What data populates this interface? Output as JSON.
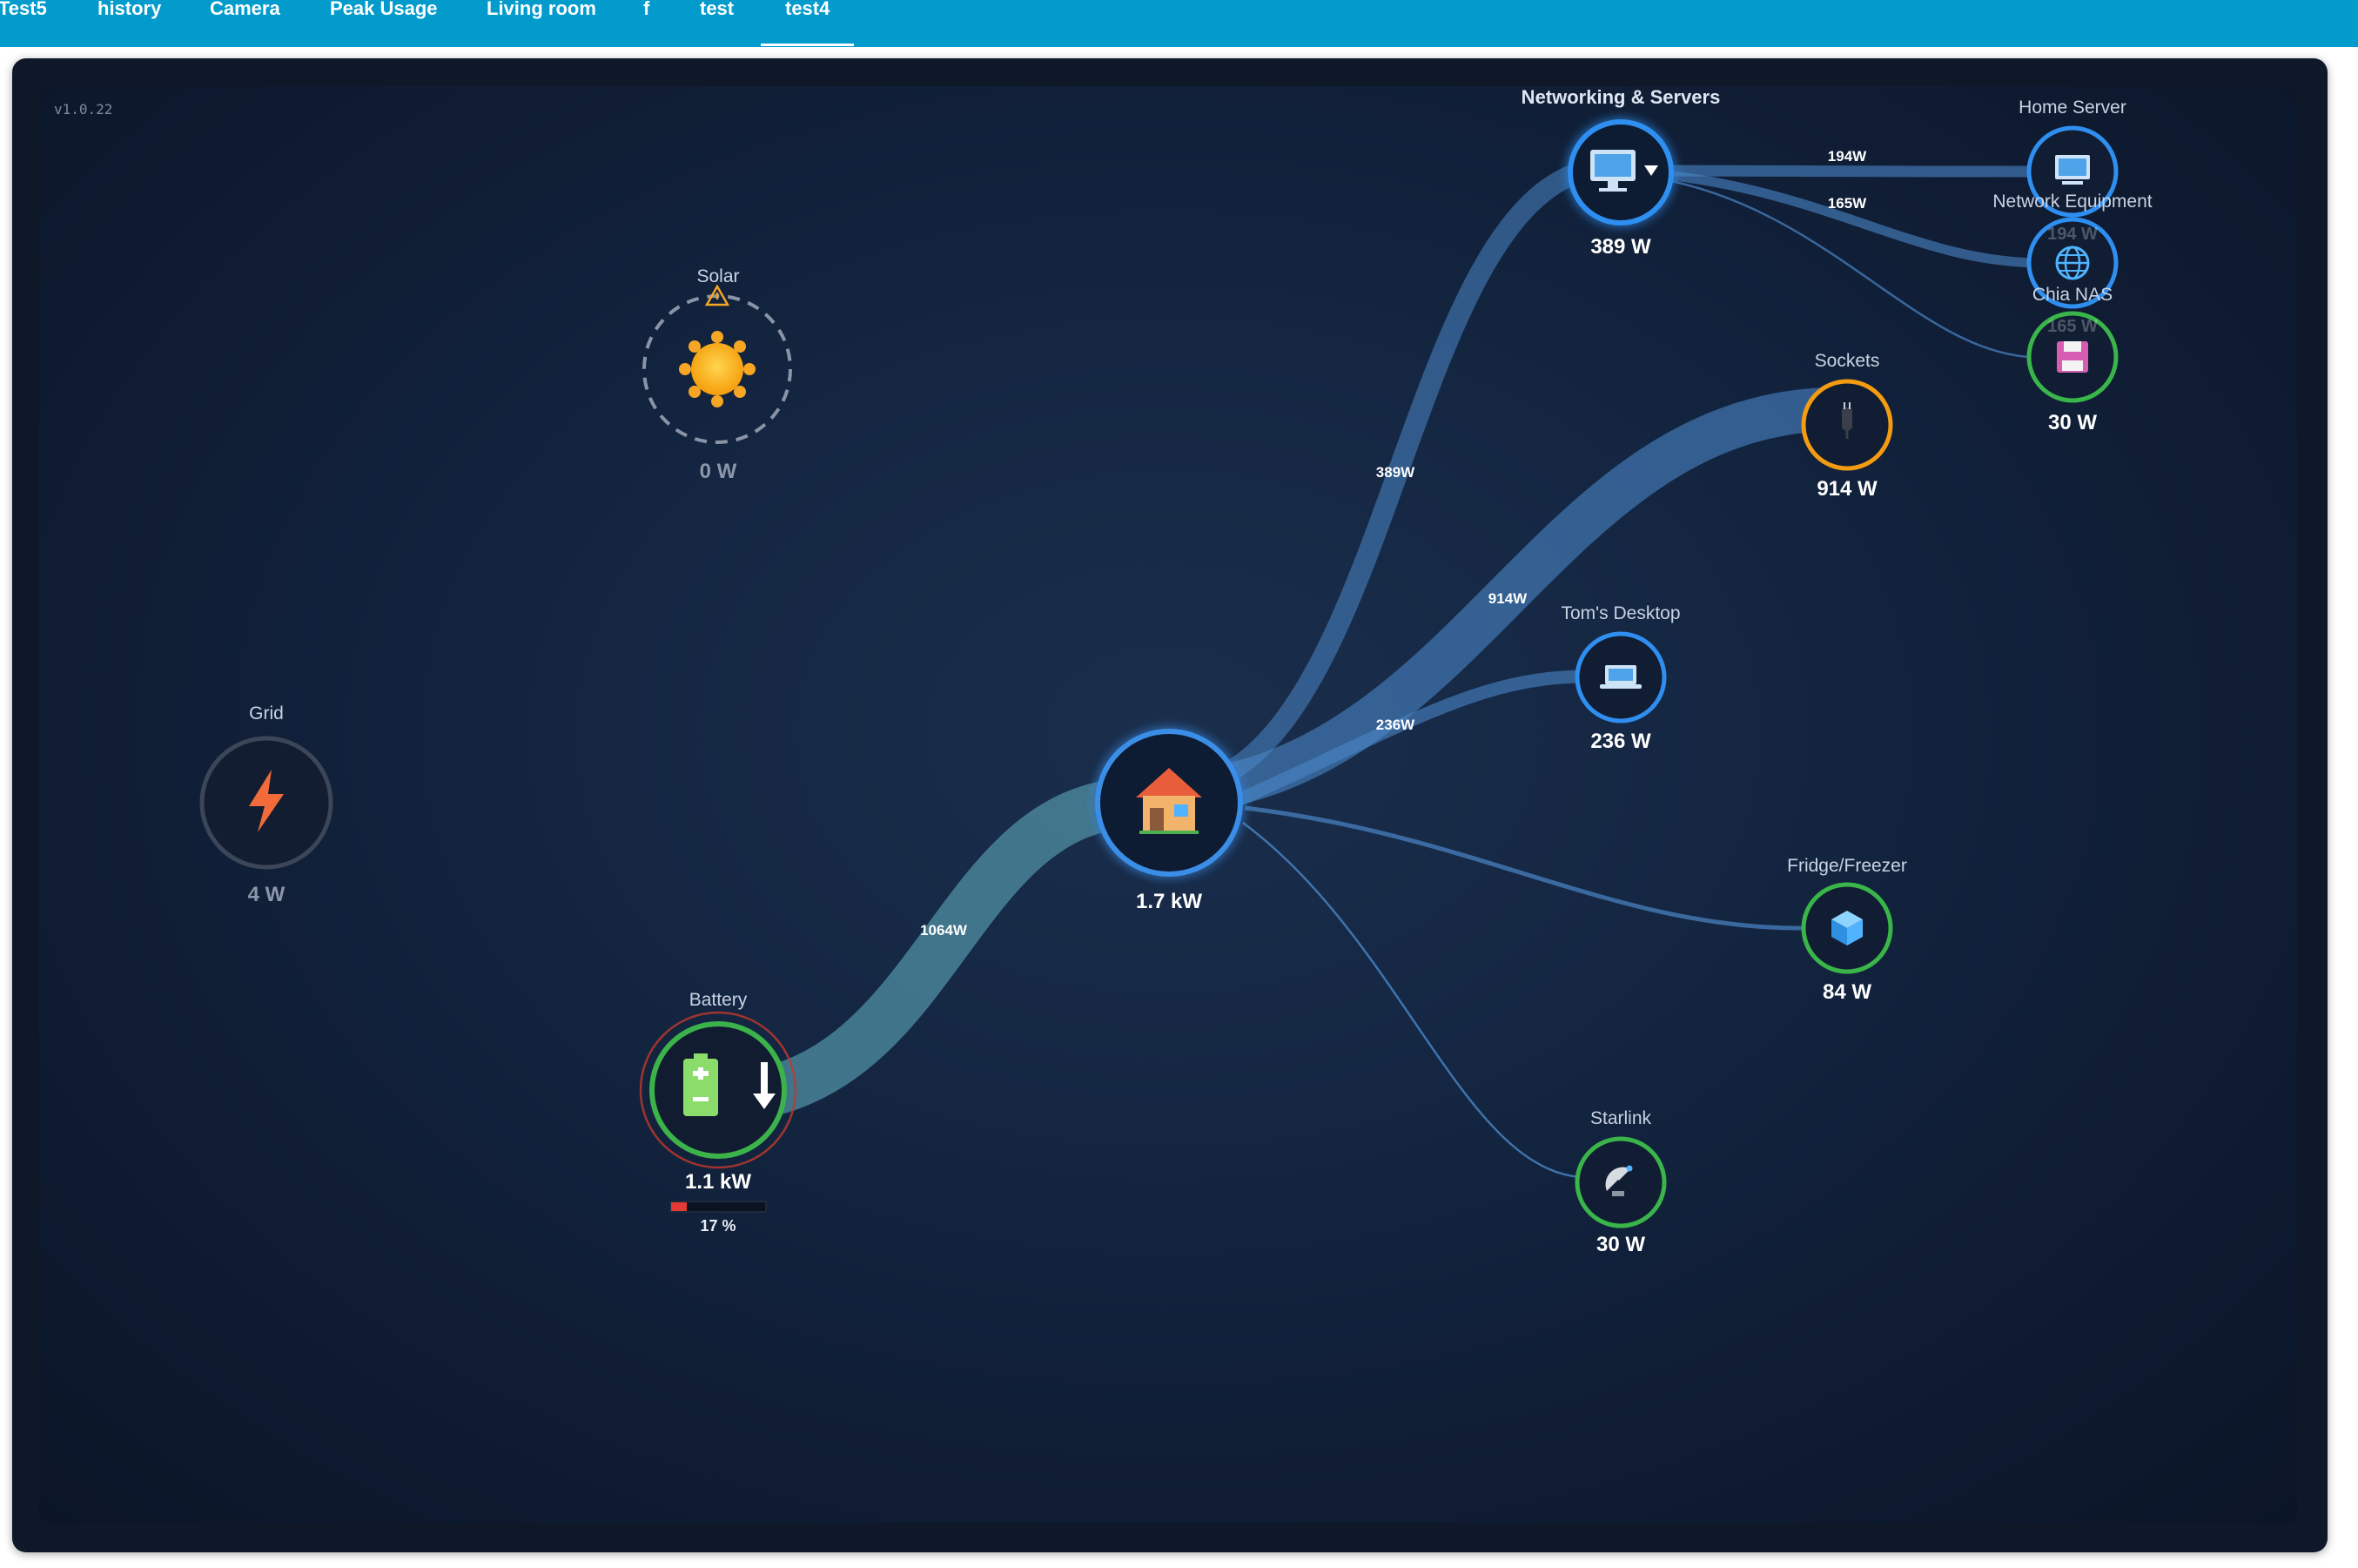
{
  "tabs": [
    {
      "label": "Test5"
    },
    {
      "label": "history"
    },
    {
      "label": "Camera"
    },
    {
      "label": "Peak Usage"
    },
    {
      "label": "Living room"
    },
    {
      "label": "f"
    },
    {
      "label": "test"
    },
    {
      "label": "test4",
      "active": true
    }
  ],
  "version": "v1.0.22",
  "colors": {
    "tabbar": "#039bcc",
    "flow": "#4b8ed0",
    "battery_flow": "#4f8fa3",
    "ring_blue": "#2f8ff0",
    "ring_green": "#39b54a",
    "ring_orange": "#f39c12",
    "ring_gray": "#3b4658",
    "battery_low": "#e53935"
  },
  "sources": {
    "solar": {
      "label": "Solar",
      "value": "0 W",
      "icon": "sun-icon",
      "warning": true
    },
    "grid": {
      "label": "Grid",
      "value": "4 W",
      "icon": "lightning-icon"
    },
    "battery": {
      "label": "Battery",
      "value": "1.1 kW",
      "icon": "battery-icon",
      "direction": "discharging",
      "percent_label": "17 %",
      "percent": 17
    }
  },
  "home": {
    "value": "1.7 kW",
    "icon": "house-icon"
  },
  "consumers": {
    "networking": {
      "label": "Networking & Servers",
      "value": "389 W",
      "icon": "computer-icon"
    },
    "home_server": {
      "label": "Home Server",
      "value": "194 W",
      "icon": "computer-icon"
    },
    "network_equipment": {
      "label": "Network Equipment",
      "value": "165 W",
      "icon": "globe-icon"
    },
    "chia_nas": {
      "label": "Chia NAS",
      "value": "30 W",
      "icon": "floppy-disk-icon"
    },
    "sockets": {
      "label": "Sockets",
      "value": "914 W",
      "icon": "plug-icon"
    },
    "toms_desktop": {
      "label": "Tom's Desktop",
      "value": "236 W",
      "icon": "laptop-icon"
    },
    "fridge": {
      "label": "Fridge/Freezer",
      "value": "84 W",
      "icon": "cube-icon"
    },
    "starlink": {
      "label": "Starlink",
      "value": "30 W",
      "icon": "satellite-dish-icon"
    }
  },
  "flows": {
    "battery_home": "1064W",
    "home_networking": "389W",
    "home_sockets": "914W",
    "home_desktop": "236W",
    "net_homeserver": "194W",
    "net_equipment": "165W"
  }
}
